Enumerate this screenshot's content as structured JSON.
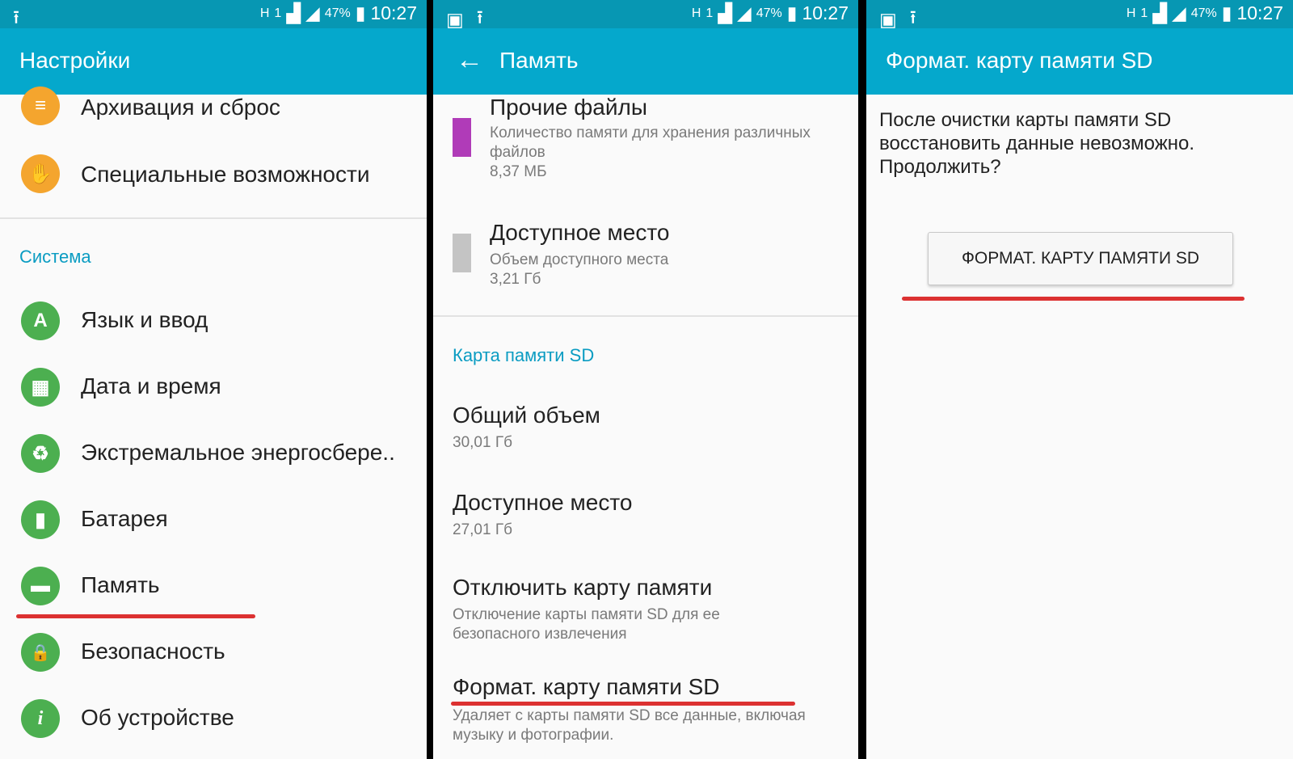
{
  "status": {
    "battery": "47%",
    "time": "10:27",
    "network": "H",
    "sim": "1"
  },
  "panel1": {
    "title": "Настройки",
    "items_top": [
      {
        "label": "Архивация и сброс",
        "icon": "backup-icon"
      },
      {
        "label": "Специальные возможности",
        "icon": "hand-icon"
      }
    ],
    "section": "Система",
    "items": [
      {
        "label": "Язык и ввод",
        "icon": "language-icon",
        "glyph": "A"
      },
      {
        "label": "Дата и время",
        "icon": "calendar-icon",
        "glyph": "▦"
      },
      {
        "label": "Экстремальное энергосбере..",
        "icon": "power-saving-icon",
        "glyph": "♻"
      },
      {
        "label": "Батарея",
        "icon": "battery-icon",
        "glyph": "▮"
      },
      {
        "label": "Память",
        "icon": "memory-card-icon",
        "glyph": "▬"
      },
      {
        "label": "Безопасность",
        "icon": "lock-icon",
        "glyph": "🔒"
      },
      {
        "label": "Об устройстве",
        "icon": "info-icon",
        "glyph": "i"
      }
    ]
  },
  "panel2": {
    "title": "Память",
    "other_files": {
      "title": "Прочие файлы",
      "desc_line1": "Количество памяти для хранения различных",
      "desc_line2": "файлов",
      "size": "8,37 МБ",
      "color": "#b03bb8"
    },
    "free_space": {
      "title": "Доступное место",
      "desc": "Объем доступного места",
      "size": "3,21 Гб",
      "color": "#c4c4c4"
    },
    "section": "Карта памяти SD",
    "total": {
      "title": "Общий объем",
      "value": "30,01 Гб"
    },
    "available": {
      "title": "Доступное место",
      "value": "27,01 Гб"
    },
    "unmount": {
      "title": "Отключить карту памяти",
      "desc_line1": "Отключение карты памяти SD для ее",
      "desc_line2": "безопасного извлечения"
    },
    "format": {
      "title": "Формат. карту памяти SD",
      "desc_line1": "Удаляет с карты памяти SD все данные, включая",
      "desc_line2": "музыку и фотографии."
    }
  },
  "panel3": {
    "title": "Формат. карту памяти SD",
    "message_line1": "После очистки карты памяти SD",
    "message_line2": "восстановить данные невозможно.",
    "message_line3": "Продолжить?",
    "button": "ФОРМАТ. КАРТУ ПАМЯТИ SD"
  },
  "colors": {
    "statusbar": "#0797b3",
    "appbar": "#05a8cc",
    "accent": "#0a9cc2",
    "highlight": "#d81b1b"
  }
}
